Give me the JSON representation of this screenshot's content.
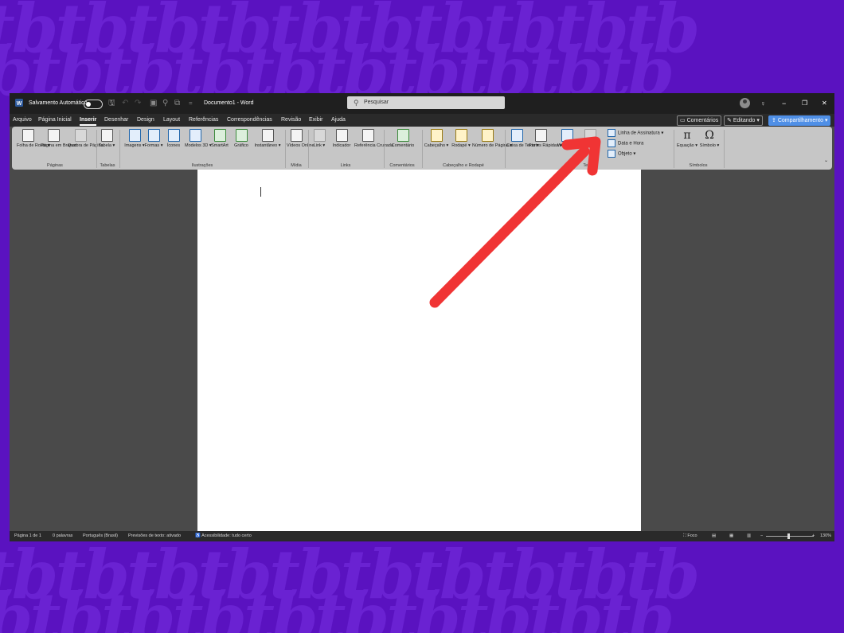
{
  "background": {
    "color": "#5a12c0",
    "watermark_text": "tbtbtbtbtbtbtbtbtbtb"
  },
  "titlebar": {
    "autosave_label": "Salvamento Automático",
    "doc_title": "Documento1  -  Word",
    "search_placeholder": "Pesquisar",
    "controls": [
      "−",
      "❐",
      "✕"
    ]
  },
  "menu": {
    "tabs": [
      "Arquivo",
      "Página Inicial",
      "Inserir",
      "Desenhar",
      "Design",
      "Layout",
      "Referências",
      "Correspondências",
      "Revisão",
      "Exibir",
      "Ajuda"
    ],
    "active_tab": "Inserir",
    "comments_btn": "Comentários",
    "editing_btn": "Editando",
    "share_btn": "Compartilhamento"
  },
  "ribbon": {
    "groups": {
      "paginas": "Páginas",
      "tabelas": "Tabelas",
      "ilustracoes": "Ilustrações",
      "midia": "Mídia",
      "links": "Links",
      "comentarios": "Comentários",
      "cabecalho": "Cabeçalho e Rodapé",
      "texto": "Texto",
      "simbolos": "Símbolos"
    },
    "buttons": {
      "folha_de_rosto": "Folha de Rosto ▾",
      "pagina_em_branco": "Página em Branco",
      "quebra_de_pagina": "Quebra de Página",
      "tabela": "Tabela ▾",
      "imagens": "Imagens ▾",
      "formas": "Formas ▾",
      "icones": "Ícones",
      "modelos_3d": "Modelos 3D ▾",
      "smartart": "SmartArt",
      "grafico": "Gráfico",
      "instantaneo": "Instantâneo ▾",
      "videos_online": "Vídeos Online",
      "link": "Link ▾",
      "indicador": "Indicador",
      "referencia_cruzada": "Referência Cruzada",
      "comentario": "Comentário",
      "cabecalho": "Cabeçalho ▾",
      "rodape": "Rodapé ▾",
      "numero_de_pagina": "Número de Página ▾",
      "caixa_de_texto": "Caixa de Texto ▾",
      "partes_rapidas": "Partes Rápidas ▾",
      "wordart": "WordArt ▾",
      "linha_de_assinatura": "Linha de Assinatura",
      "data_e_hora": "Data e Hora",
      "objeto": "Objeto",
      "equacao": "Equação ▾",
      "simbolo": "Símbolo ▾"
    }
  },
  "status": {
    "page": "Página 1 de 1",
    "words": "0 palavras",
    "language": "Português (Brasil)",
    "predictions": "Previsões de texto: ativado",
    "accessibility": "Acessibilidade: tudo certo",
    "focus": "Foco",
    "zoom": "130%"
  },
  "annotation": {
    "arrow_color": "#f03434"
  }
}
